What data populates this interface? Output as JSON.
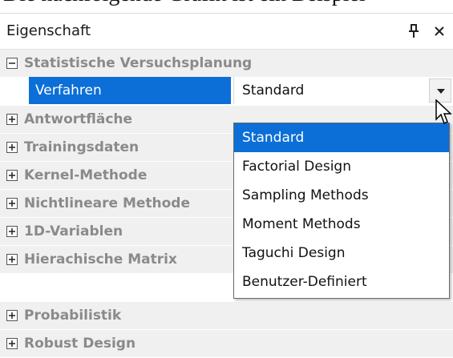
{
  "top_clipped_text": "Die nachfolgende Grafik ist ein Beispiel",
  "panel": {
    "title": "Eigenschaft"
  },
  "groups": [
    {
      "label": "Statistische Versuchsplanung",
      "expanded": true
    },
    {
      "label": "Antwortfläche",
      "expanded": false
    },
    {
      "label": "Trainingsdaten",
      "expanded": false
    },
    {
      "label": "Kernel-Methode",
      "expanded": false
    },
    {
      "label": "Nichtlineare Methode",
      "expanded": false
    },
    {
      "label": "1D-Variablen",
      "expanded": false
    },
    {
      "label": "Hierachische Matrix",
      "expanded": false
    },
    {
      "label": "Probabilistik",
      "expanded": false
    },
    {
      "label": "Robust Design",
      "expanded": false
    }
  ],
  "property": {
    "name": "Verfahren",
    "value": "Standard"
  },
  "dropdown_options": [
    "Standard",
    "Factorial Design",
    "Sampling Methods",
    "Moment Methods",
    "Taguchi Design",
    "Benutzer-Definiert"
  ],
  "selected_option": "Standard",
  "colors": {
    "selection": "#0b6fd7",
    "group_bg": "#f0f0f0",
    "group_text": "#8a8a8a"
  },
  "icons": {
    "pin": "pin-icon",
    "close": "close-icon",
    "collapse": "minus-box-icon",
    "expand": "plus-box-icon",
    "dropdown": "chevron-down-icon",
    "cursor": "mouse-cursor-icon"
  }
}
